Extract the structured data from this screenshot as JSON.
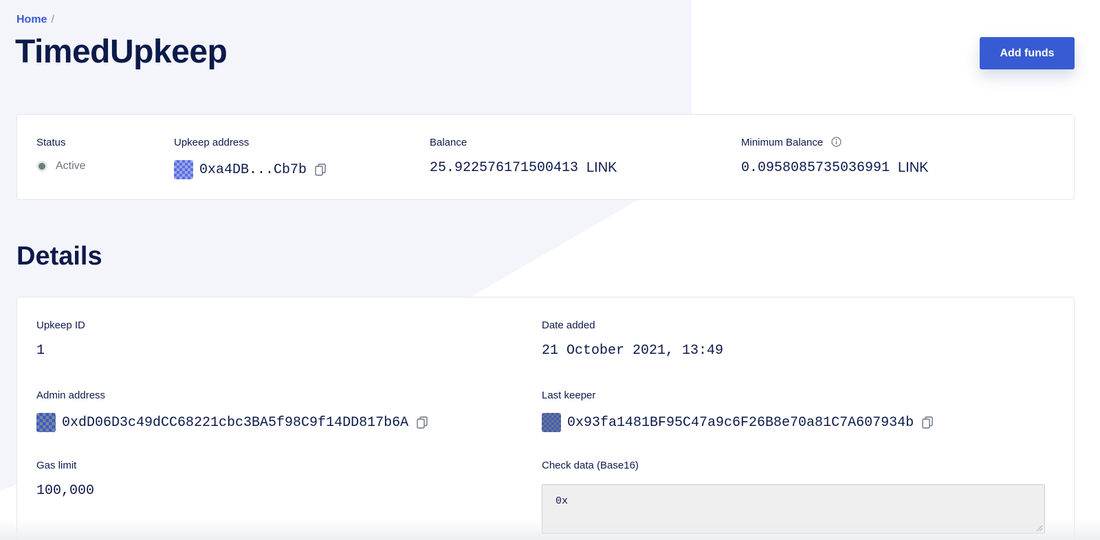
{
  "breadcrumb": {
    "home": "Home",
    "separator": "/"
  },
  "page_title": "TimedUpkeep",
  "actions": {
    "add_funds": "Add funds"
  },
  "summary": {
    "status": {
      "label": "Status",
      "value": "Active"
    },
    "upkeep_address": {
      "label": "Upkeep address",
      "value": "0xa4DB...Cb7b"
    },
    "balance": {
      "label": "Balance",
      "value": "25.922576171500413",
      "unit": "LINK"
    },
    "minimum_balance": {
      "label": "Minimum Balance",
      "value": "0.0958085735036991",
      "unit": "LINK"
    }
  },
  "details": {
    "title": "Details",
    "upkeep_id": {
      "label": "Upkeep ID",
      "value": "1"
    },
    "date_added": {
      "label": "Date added",
      "value": "21 October 2021, 13:49"
    },
    "admin_address": {
      "label": "Admin address",
      "value": "0xdD06D3c49dCC68221cbc3BA5f98C9f14DD817b6A"
    },
    "last_keeper": {
      "label": "Last keeper",
      "value": "0x93fa1481BF95C47a9c6F26B8e70a81C7A607934b"
    },
    "gas_limit": {
      "label": "Gas limit",
      "value": "100,000"
    },
    "check_data": {
      "label": "Check data (Base16)",
      "value": "0x"
    }
  },
  "icons": {
    "copy": "copy-icon",
    "info": "info-icon",
    "status_indicator": "status-dot"
  },
  "colors": {
    "accent": "#375bd2",
    "heading": "#0c1a4b",
    "background_shape": "#f4f5fa"
  }
}
